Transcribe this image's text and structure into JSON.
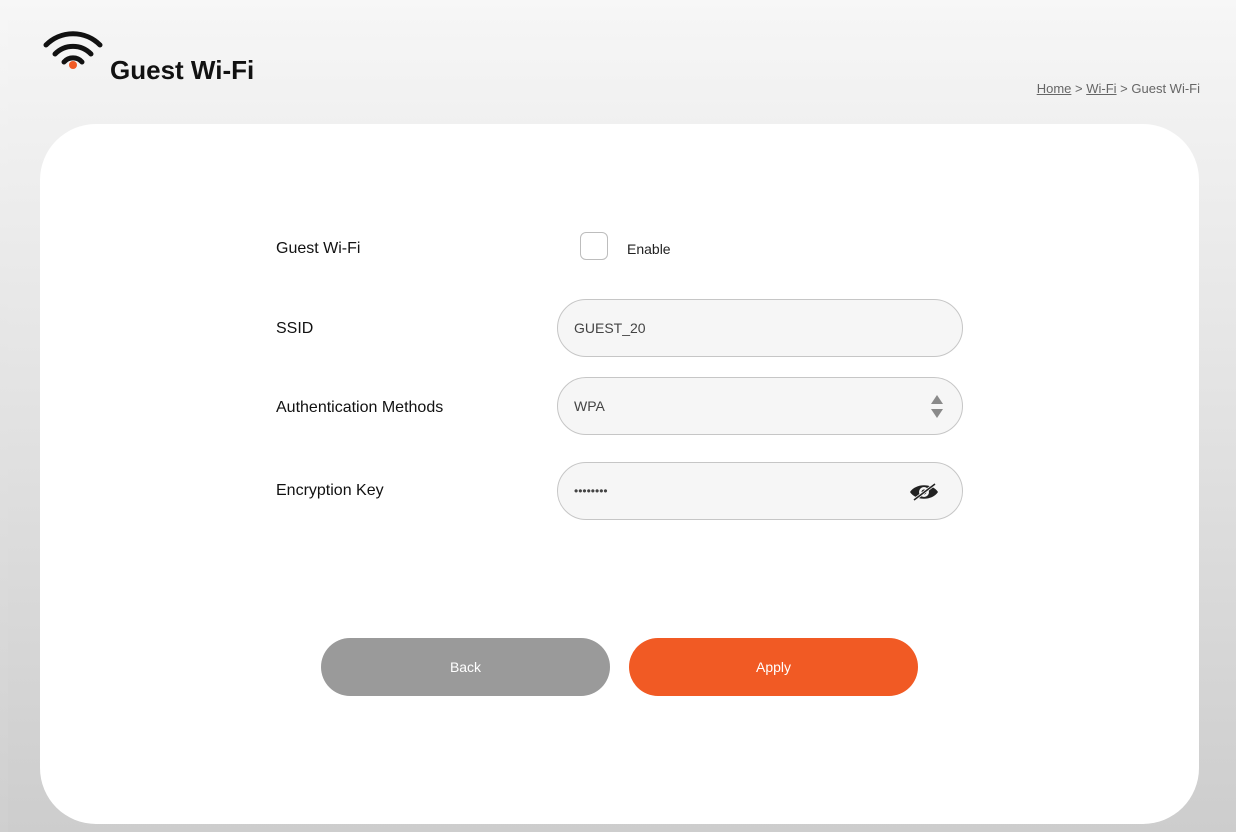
{
  "header": {
    "title": "Guest Wi-Fi",
    "breadcrumb": {
      "home": "Home",
      "sep1": " > ",
      "wifi": "Wi-Fi",
      "sep2": " > ",
      "current": "Guest Wi-Fi"
    }
  },
  "form": {
    "guest_wifi": {
      "label": "Guest Wi-Fi",
      "checkbox_label": "Enable",
      "checked": false
    },
    "ssid": {
      "label": "SSID",
      "value": "GUEST_20"
    },
    "auth": {
      "label": "Authentication Methods",
      "value": "WPA"
    },
    "key": {
      "label": "Encryption Key",
      "value": "••••••••"
    }
  },
  "buttons": {
    "back": "Back",
    "apply": "Apply"
  },
  "colors": {
    "accent": "#f15a24",
    "back_button": "#9a9a9a"
  },
  "icons": {
    "logo": "wifi-icon",
    "select": "sort-arrows-icon",
    "password_toggle": "eye-slash-icon"
  }
}
